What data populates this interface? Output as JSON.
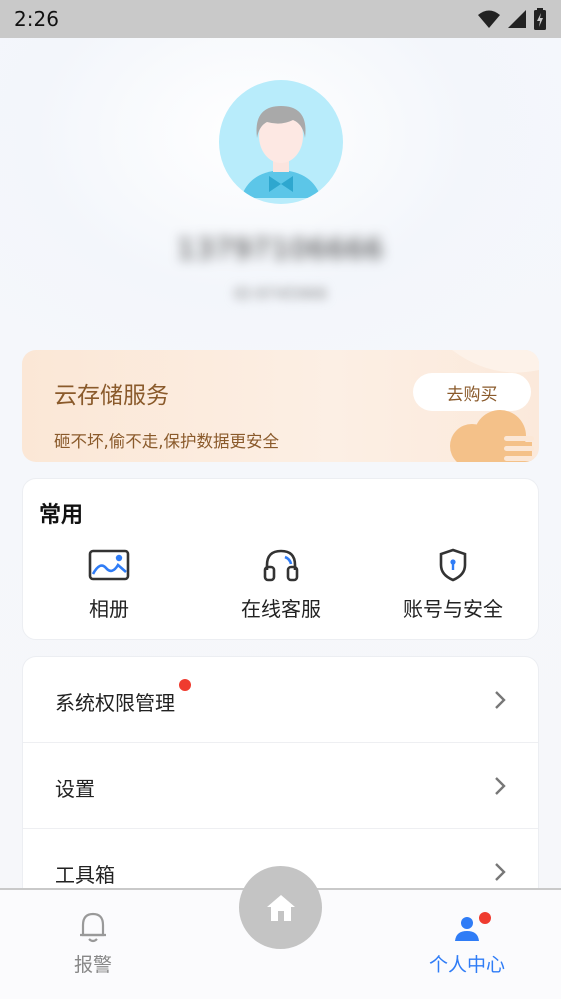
{
  "status_bar": {
    "time": "2:26"
  },
  "profile": {
    "username": "13797106666",
    "user_id": "ID:9745966"
  },
  "cloud_storage": {
    "title": "云存储服务",
    "subtitle": "砸不坏,偷不走,保护数据更安全",
    "buy_label": "去购买"
  },
  "common": {
    "title": "常用",
    "items": [
      {
        "label": "相册",
        "icon": "album-icon"
      },
      {
        "label": "在线客服",
        "icon": "headset-icon"
      },
      {
        "label": "账号与安全",
        "icon": "shield-icon"
      }
    ]
  },
  "menu": {
    "items": [
      {
        "label": "系统权限管理",
        "has_badge": true
      },
      {
        "label": "设置",
        "has_badge": false
      },
      {
        "label": "工具箱",
        "has_badge": false
      }
    ]
  },
  "bottom_nav": {
    "tabs": [
      {
        "label": "报警",
        "icon": "bell-icon",
        "active": false
      },
      {
        "label": "个人中心",
        "icon": "person-icon",
        "active": true,
        "has_badge": true
      }
    ],
    "home_icon": "home-icon"
  },
  "colors": {
    "accent_blue": "#2f7cf6",
    "cloud_text": "#8a5a2b",
    "badge_red": "#ef3b2f",
    "avatar_bg": "#b8ecfb"
  }
}
